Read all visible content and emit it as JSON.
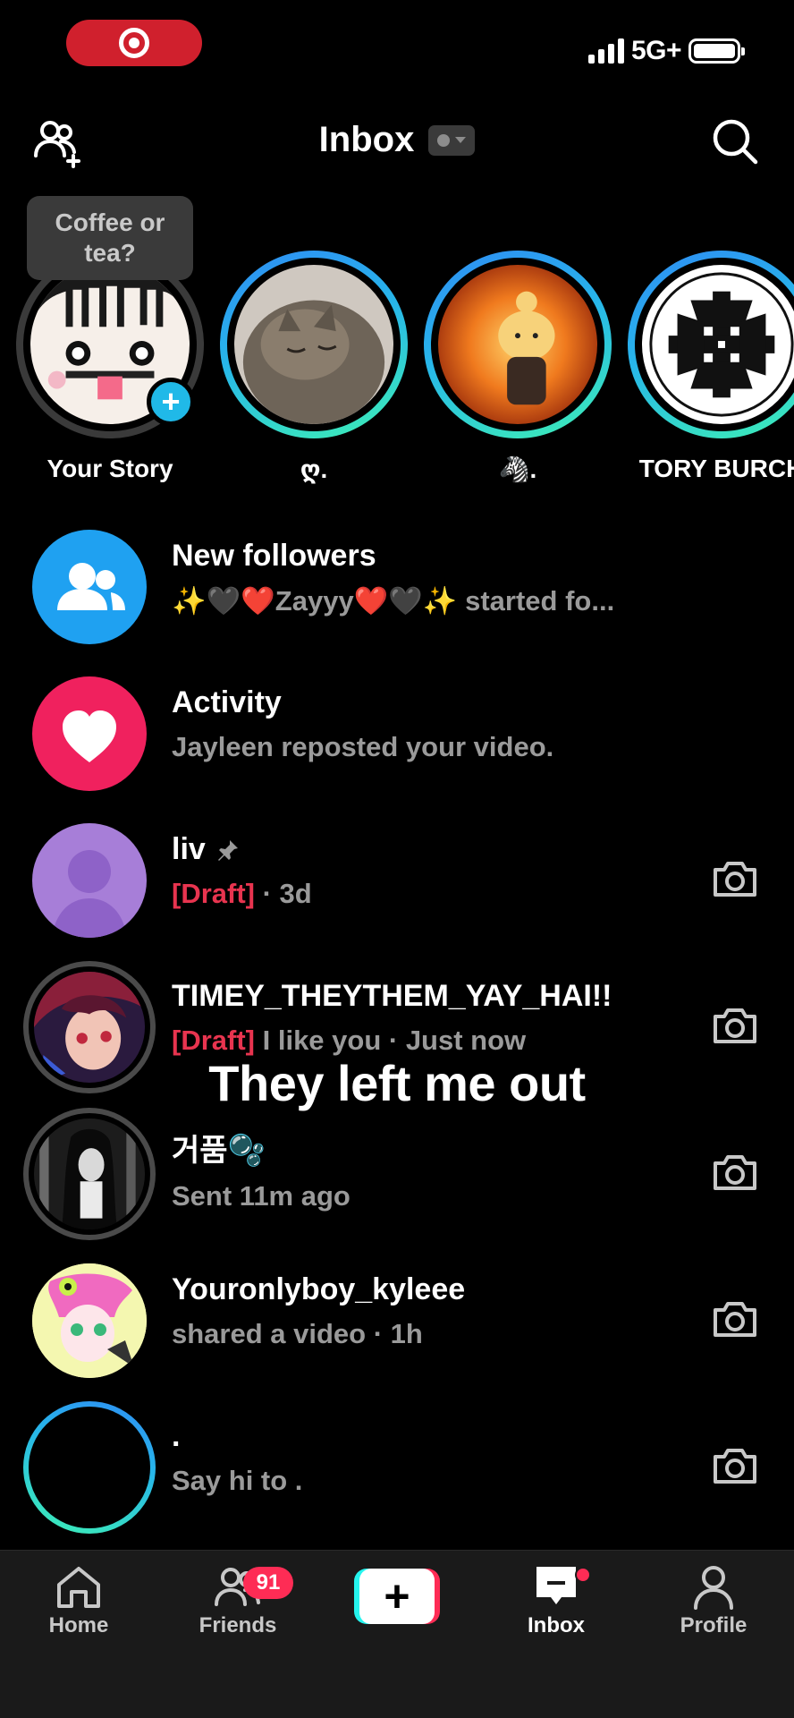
{
  "status_bar": {
    "network": "5G+",
    "colors": {
      "recording_pill": "#d0202d"
    }
  },
  "header": {
    "title": "Inbox"
  },
  "tooltip": {
    "text": "Coffee or tea?"
  },
  "stories": [
    {
      "name": "Your Story",
      "ring": "grey",
      "has_add_badge": true,
      "add_badge": "+"
    },
    {
      "name": "ღ.",
      "ring": "gradient"
    },
    {
      "name": "🦓.",
      "ring": "gradient"
    },
    {
      "name": "TORY BURCH",
      "ring": "gradient"
    }
  ],
  "rows": [
    {
      "title": "New followers",
      "subtitle": "✨🖤❤️Zayyy❤️🖤✨ started fo...",
      "avatar_icon": "people-icon",
      "avatar_color": "#1fa1f1"
    },
    {
      "title": "Activity",
      "subtitle": "Jayleen reposted your video.",
      "avatar_icon": "heart-icon",
      "avatar_color": "#f0215e"
    },
    {
      "title": "liv",
      "pinned": true,
      "draft": "[Draft]",
      "subtitle": " · 3d"
    },
    {
      "title": "TIMEY_THEYTHEM_YAY_HAI!!",
      "draft": "[Draft]",
      "subtitle": " I like you  · Just now"
    },
    {
      "title": "거품🫧",
      "subtitle": "Sent 11m ago"
    },
    {
      "title": "Youronlyboy_kyleee",
      "subtitle": "shared a video · 1h"
    },
    {
      "title": ".",
      "subtitle": "Say hi to ."
    }
  ],
  "overlay_caption": "They left me out",
  "tabbar": {
    "home": "Home",
    "friends": "Friends",
    "friends_badge": "91",
    "create": "+",
    "inbox": "Inbox",
    "profile": "Profile",
    "active": "Inbox",
    "colors": {
      "accent": "#fe2c55",
      "cyan": "#25f4ee"
    }
  }
}
